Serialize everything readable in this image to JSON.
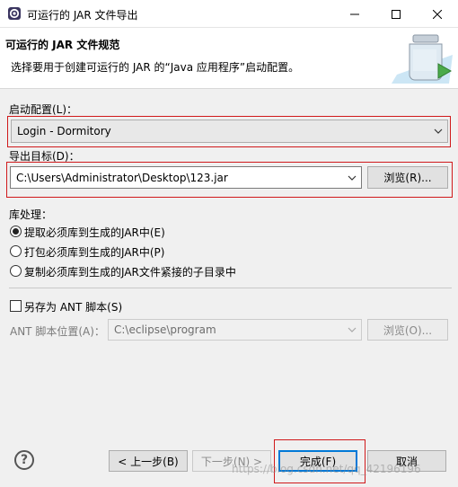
{
  "window": {
    "title": "可运行的 JAR 文件导出",
    "icon": "eclipse-gear-icon"
  },
  "banner": {
    "title": "可运行的 JAR 文件规范",
    "description": "选择要用于创建可运行的 JAR 的“Java 应用程序”启动配置。",
    "icon": "jar-export-icon"
  },
  "launch_config": {
    "label": "启动配置(L)：",
    "value": "Login - Dormitory"
  },
  "export_target": {
    "label": "导出目标(D)：",
    "value": "C:\\Users\\Administrator\\Desktop\\123.jar",
    "browse_label": "浏览(R)..."
  },
  "library_handling": {
    "label": "库处理：",
    "options": [
      {
        "label": "提取必须库到生成的JAR中(E)",
        "checked": true
      },
      {
        "label": "打包必须库到生成的JAR中(P)",
        "checked": false
      },
      {
        "label": "复制必须库到生成的JAR文件紧接的子目录中",
        "checked": false
      }
    ]
  },
  "ant": {
    "save_label": "另存为 ANT 脚本(S)",
    "checked": false,
    "location_label": "ANT 脚本位置(A)：",
    "location_value": "C:\\eclipse\\program",
    "browse_label": "浏览(O)..."
  },
  "footer": {
    "back_label": "< 上一步(B)",
    "next_label": "下一步(N) >",
    "finish_label": "完成(F)",
    "cancel_label": "取消"
  },
  "watermark": "https://blog.csdn.net/qq_42196196",
  "colors": {
    "highlight_frame": "#d0191b",
    "dialog_bg": "#f0f0f0",
    "focus_blue": "#0078d7"
  }
}
